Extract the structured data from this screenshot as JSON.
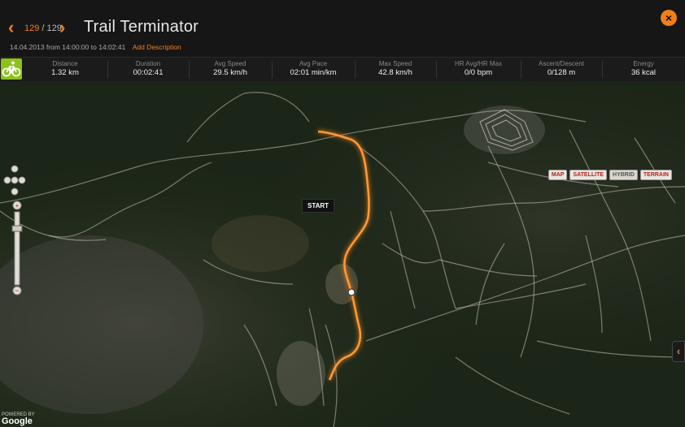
{
  "header": {
    "prev_icon": "‹",
    "next_icon": "›",
    "current": "129",
    "total": "129",
    "separator": "/",
    "title": "Trail Terminator",
    "date": "14.04.2013",
    "from_label": "from",
    "from_time": "14:00:00",
    "to_label": "to",
    "to_time": "14:02:41",
    "add_description": "Add Description",
    "close_icon": "×"
  },
  "stats": [
    {
      "label": "Distance",
      "value": "1.32 km"
    },
    {
      "label": "Duration",
      "value": "00:02:41"
    },
    {
      "label": "Avg Speed",
      "value": "29.5 km/h"
    },
    {
      "label": "Avg Pace",
      "value": "02:01 min/km"
    },
    {
      "label": "Max Speed",
      "value": "42.8 km/h"
    },
    {
      "label": "HR Avg/HR Max",
      "value": "0/0 bpm"
    },
    {
      "label": "Ascent/Descent",
      "value": "0/128 m"
    },
    {
      "label": "Energy",
      "value": "36 kcal"
    }
  ],
  "map": {
    "buttons": [
      "MAP",
      "SATELLITE",
      "HYBRID",
      "TERRAIN"
    ],
    "active_button": "HYBRID",
    "start_label": "START",
    "powered_by": "POWERED BY",
    "google": "Google",
    "expand_icon": "‹",
    "route_color": "#f07f1a",
    "accent_color": "#f07f1a",
    "sport_color": "#8cc21a"
  }
}
